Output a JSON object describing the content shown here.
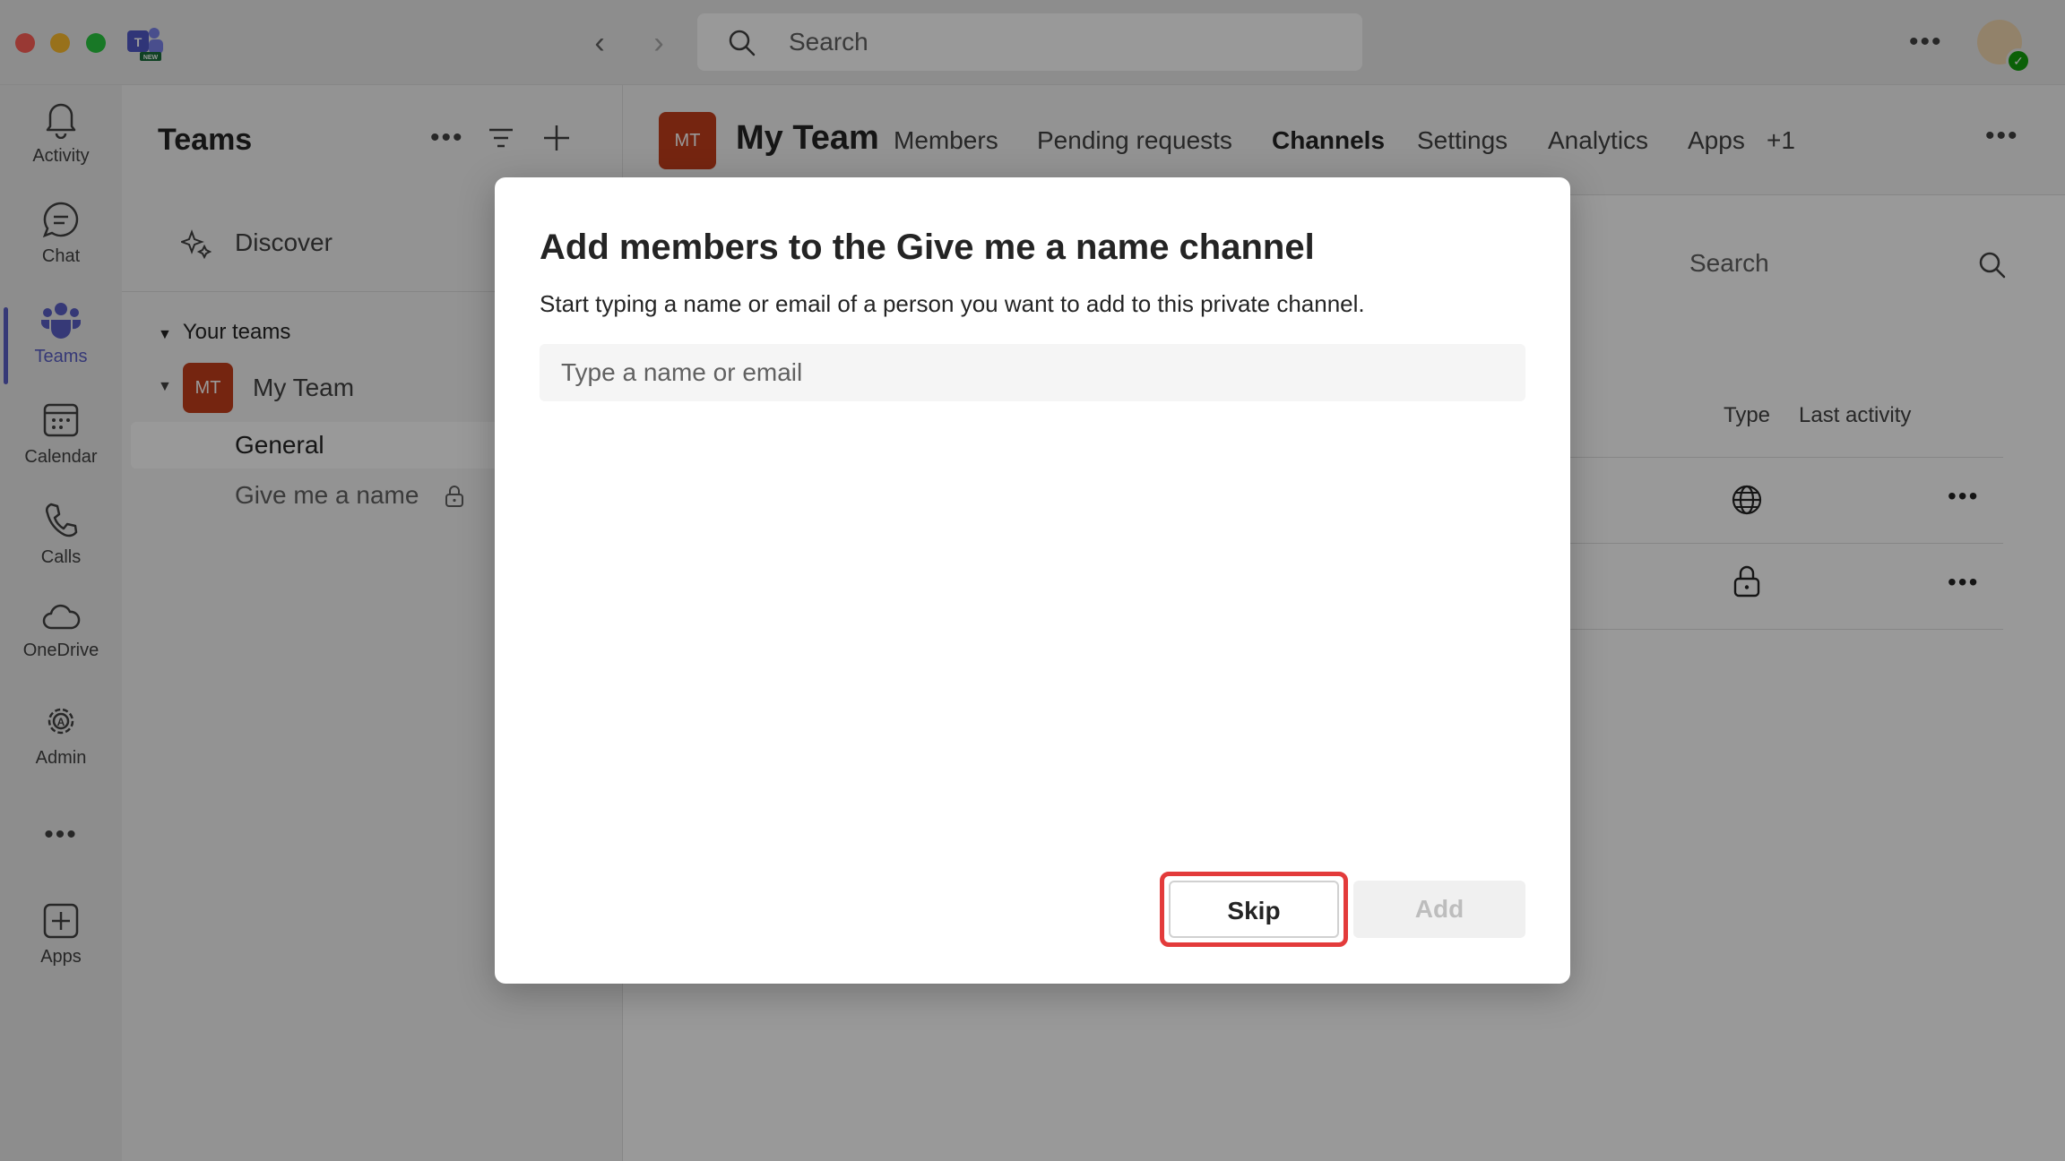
{
  "titlebar": {
    "search_placeholder": "Search",
    "app_logo_badge": "NEW"
  },
  "rail": {
    "items": [
      {
        "label": "Activity",
        "icon": "bell-icon"
      },
      {
        "label": "Chat",
        "icon": "chat-icon"
      },
      {
        "label": "Teams",
        "icon": "teams-icon",
        "active": true
      },
      {
        "label": "Calendar",
        "icon": "calendar-icon"
      },
      {
        "label": "Calls",
        "icon": "phone-icon"
      },
      {
        "label": "OneDrive",
        "icon": "cloud-icon"
      },
      {
        "label": "Admin",
        "icon": "admin-gear-icon"
      },
      {
        "label": "Apps",
        "icon": "add-app-icon"
      }
    ]
  },
  "teams_pane": {
    "title": "Teams",
    "discover": "Discover",
    "your_teams": "Your teams",
    "team": {
      "initials": "MT",
      "name": "My Team"
    },
    "channels": [
      {
        "name": "General",
        "selected": true
      },
      {
        "name": "Give me a name",
        "private": true
      }
    ]
  },
  "main": {
    "team_initials": "MT",
    "team_name": "My Team",
    "tabs": [
      "Members",
      "Pending requests",
      "Channels",
      "Settings",
      "Analytics",
      "Apps",
      "+1"
    ],
    "active_tab": "Channels",
    "search_placeholder": "Search",
    "columns": {
      "type": "Type",
      "last_activity": "Last activity"
    }
  },
  "dialog": {
    "title": "Add members to the Give me a name channel",
    "subtitle": "Start typing a name or email of a person you want to add to this private channel.",
    "input_placeholder": "Type a name or email",
    "skip_label": "Skip",
    "add_label": "Add"
  },
  "colors": {
    "accent": "#5b5fc7",
    "team_badge": "#c43e1c",
    "highlight": "#e33b3b"
  }
}
